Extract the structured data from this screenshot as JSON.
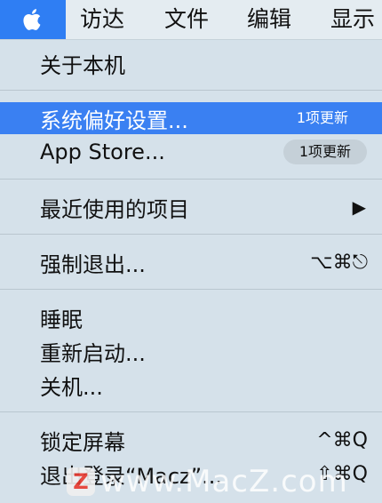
{
  "menubar": {
    "apple_icon": "apple-logo-icon",
    "items": [
      "访达",
      "文件",
      "编辑",
      "显示"
    ]
  },
  "menu": {
    "about": "关于本机",
    "system_prefs": {
      "label": "系统偏好设置...",
      "badge": "1项更新"
    },
    "app_store": {
      "label": "App Store...",
      "badge": "1项更新"
    },
    "recent_items": {
      "label": "最近使用的项目",
      "arrow": "▶"
    },
    "force_quit": {
      "label": "强制退出...",
      "shortcut": "⌥⌘⎋"
    },
    "sleep": "睡眠",
    "restart": "重新启动...",
    "shutdown": "关机...",
    "lock_screen": {
      "label": "锁定屏幕",
      "shortcut": "^⌘Q"
    },
    "logout": {
      "label": "退出登录“Macz”...",
      "shortcut": "⇧⌘Q"
    }
  },
  "watermark": {
    "logo": "Z",
    "text": "www.MacZ.com"
  },
  "colors": {
    "highlight": "#3a80f2",
    "menu_bg": "#d5e1ea",
    "menubar_bg": "#e4ecf1"
  }
}
